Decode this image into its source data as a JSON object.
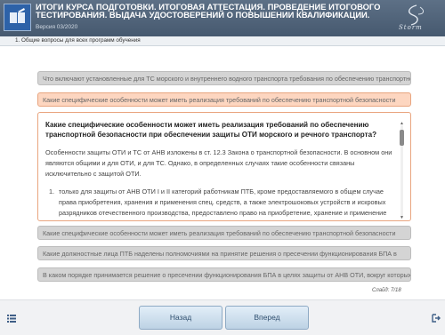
{
  "header": {
    "title": "ИТОГИ КУРСА ПОДГОТОВКИ. ИТОГОВАЯ АТТЕСТАЦИЯ. ПРОВЕДЕНИЕ ИТОГОВОГО ТЕСТИРОВАНИЯ. ВЫДАЧА УДОСТОВЕРЕНИЙ О ПОВЫШЕНИИ КВАЛИФИКАЦИИ.",
    "version": "Версия 03/2020",
    "brand": "Storm"
  },
  "breadcrumb": "1. Общие вопросы для всех программ обучения",
  "questions": [
    "Что включают установленные для ТС морского и внутреннего водного транспорта требования по обеспечению транспортной безопасности",
    "Какие специфические особенности может иметь реализация требований по обеспечению транспортной безопасности",
    "Какие специфические особенности может иметь реализация требований по обеспечению транспортной безопасности",
    "Какие должностные лица ПТБ наделены полномочиями на принятие решения о пресечении функционирования БПА в",
    "В каком порядке принимается решение о пресечении функционирования БПА в целях защиты от АНВ ОТИ, вокруг которых"
  ],
  "answer": {
    "title": "Какие специфические особенности может иметь реализация требований по обеспечению транспортной безопасности при обеспечении защиты ОТИ морского и речного транспорта?",
    "paragraph": "Особенности защиты ОТИ и ТС от АНВ изложены в ст. 12.3 Закона о транспортной безопасности. В основном они являются общими и для ОТИ, и для ТС. Однако, в определенных случаях такие особенности связаны исключительно с защитой ОТИ.",
    "list_number": "1.",
    "list_item": "только для защиты от АНВ ОТИ I и II категорий работникам ПТБ, кроме предоставляемого в общем случае права приобретения, хранения и применения спец. средств, а также электрошоковых устройств и искровых разрядников отечественного производства, предоставлено право на приобретение, хранение и применение"
  },
  "slide_counter": "Слайд: 7/18",
  "buttons": {
    "back": "Назад",
    "forward": "Вперед"
  },
  "icons": {
    "menu": "menu-icon",
    "exit": "exit-icon",
    "logo": "book-icon",
    "scroll_up": "triangle-up-icon",
    "scroll_down": "triangle-down-icon"
  },
  "colors": {
    "header": "#4d6177",
    "active_row": "#fdd6c0",
    "active_border": "#e8a57f",
    "button": "#c9dcec"
  }
}
